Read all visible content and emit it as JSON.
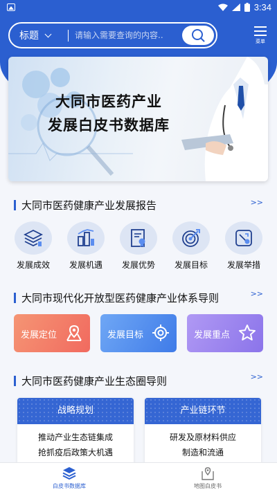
{
  "status_bar": {
    "time": "3:34"
  },
  "header": {
    "field_label": "标题",
    "search_placeholder": "请输入需要查询的内容..",
    "menu_label": "菜单"
  },
  "banner": {
    "title_line1": "大同市医药产业",
    "title_line2": "发展白皮书数据库"
  },
  "section1": {
    "title": "大同市医药健康产业发展报告",
    "more": ">>",
    "items": [
      {
        "label": "发展成效",
        "icon": "layers-chart-icon"
      },
      {
        "label": "发展机遇",
        "icon": "buildings-chart-icon"
      },
      {
        "label": "发展优势",
        "icon": "document-award-icon"
      },
      {
        "label": "发展目标",
        "icon": "target-icon"
      },
      {
        "label": "发展举措",
        "icon": "tools-card-icon"
      }
    ]
  },
  "section2": {
    "title": "大同市现代化开放型医药健康产业体系导则",
    "more": ">>",
    "cards": [
      {
        "label": "发展定位",
        "icon": "location-icon",
        "color": "#f27a66"
      },
      {
        "label": "发展目标",
        "icon": "crosshair-icon",
        "color": "#4d86ea"
      },
      {
        "label": "发展重点",
        "icon": "star-icon",
        "color": "#9a82ef"
      }
    ]
  },
  "section3": {
    "title": "大同市医药健康产业生态圈导则",
    "more": ">>",
    "panels": [
      {
        "header": "战略规划",
        "lines": [
          "推动产业生态链集成",
          "抢抓疫后政策大机遇"
        ]
      },
      {
        "header": "产业链环节",
        "lines": [
          "研发及原材料供应",
          "制造和流通"
        ]
      }
    ]
  },
  "tabbar": {
    "tabs": [
      {
        "label": "白皮书数据库",
        "active": true
      },
      {
        "label": "地图白皮书",
        "active": false
      }
    ]
  },
  "colors": {
    "primary": "#2b5fd0",
    "orange": "#f27a66",
    "blue": "#4d86ea",
    "purple": "#9a82ef"
  }
}
